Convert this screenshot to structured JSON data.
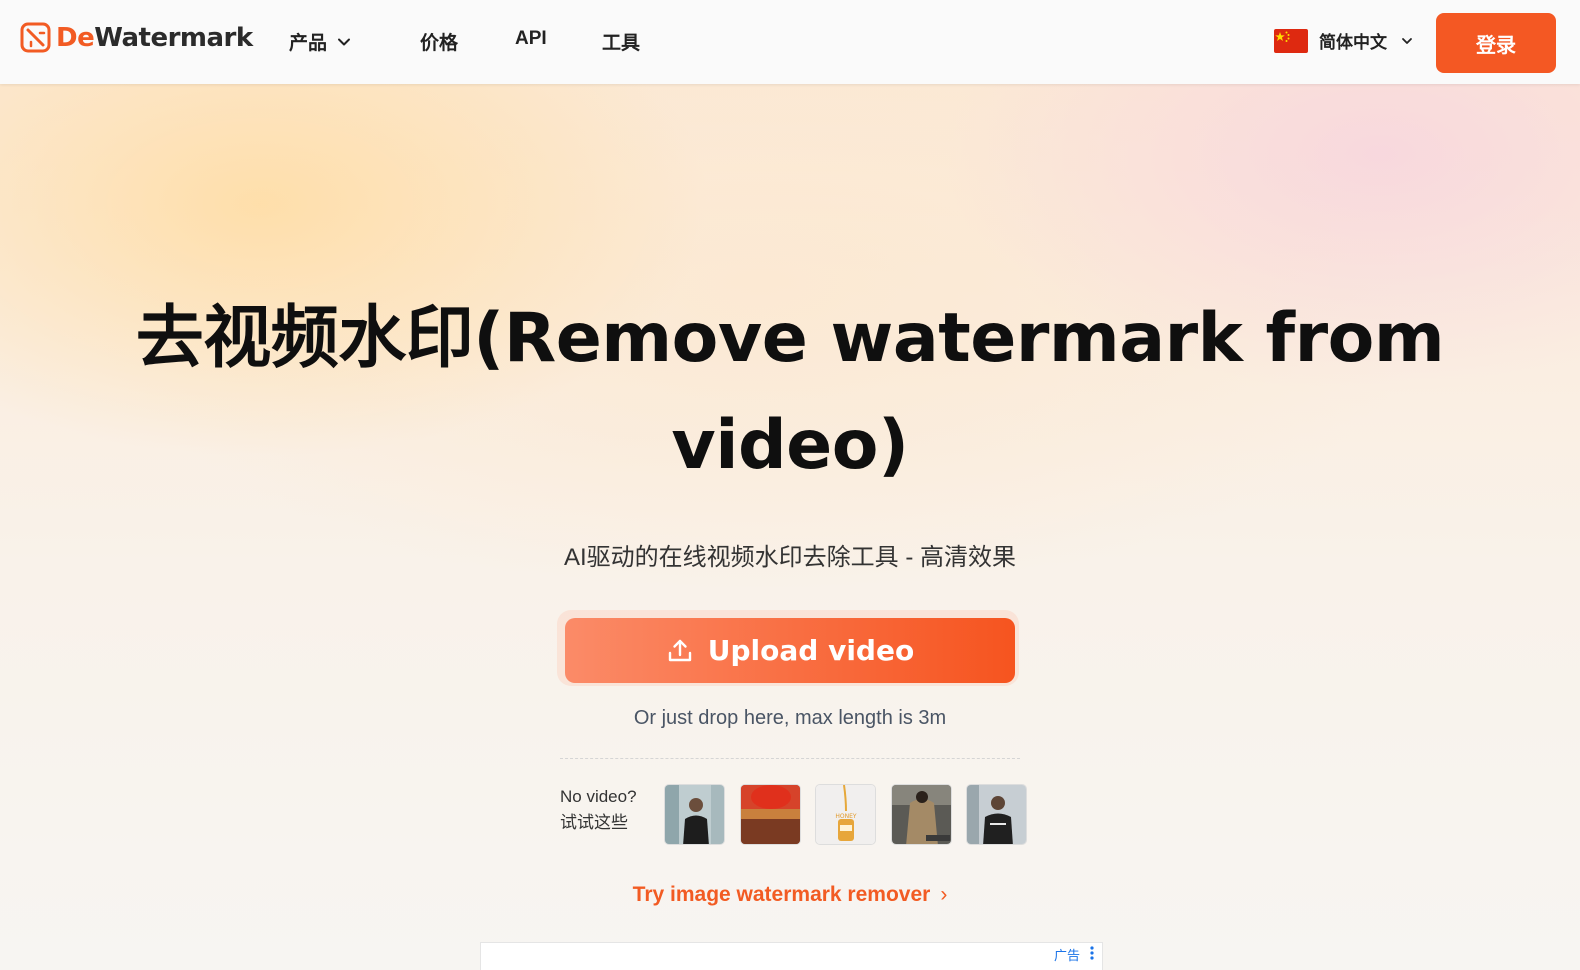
{
  "header": {
    "logo": {
      "de": "De",
      "wm": "Watermark"
    },
    "nav": {
      "products": "产品",
      "pricing": "价格",
      "api": "API",
      "tools": "工具"
    },
    "language": {
      "selected": "简体中文",
      "flag_icon": "china-flag-icon"
    },
    "login_label": "登录"
  },
  "hero": {
    "title": "去视频水印(Remove watermark from video)",
    "subtitle": "AI驱动的在线视频水印去除工具 - 高清效果",
    "upload_label": "Upload video",
    "drop_hint": "Or just drop here, max length is 3m",
    "samples_label_line1": "No video?",
    "samples_label_line2": "试试这些",
    "samples": [
      "sample-man-black-tee",
      "sample-red-sky-field",
      "sample-honey-jar",
      "sample-woman-jacket",
      "sample-man-logo-tee"
    ],
    "try_image_link": "Try image watermark remover",
    "try_image_arrow": "›"
  },
  "ad": {
    "label": "广告"
  },
  "colors": {
    "brand": "#f25b23",
    "login_bg": "#f45823",
    "upload_gradient_start": "#fb8b68",
    "upload_gradient_end": "#f6541f"
  }
}
